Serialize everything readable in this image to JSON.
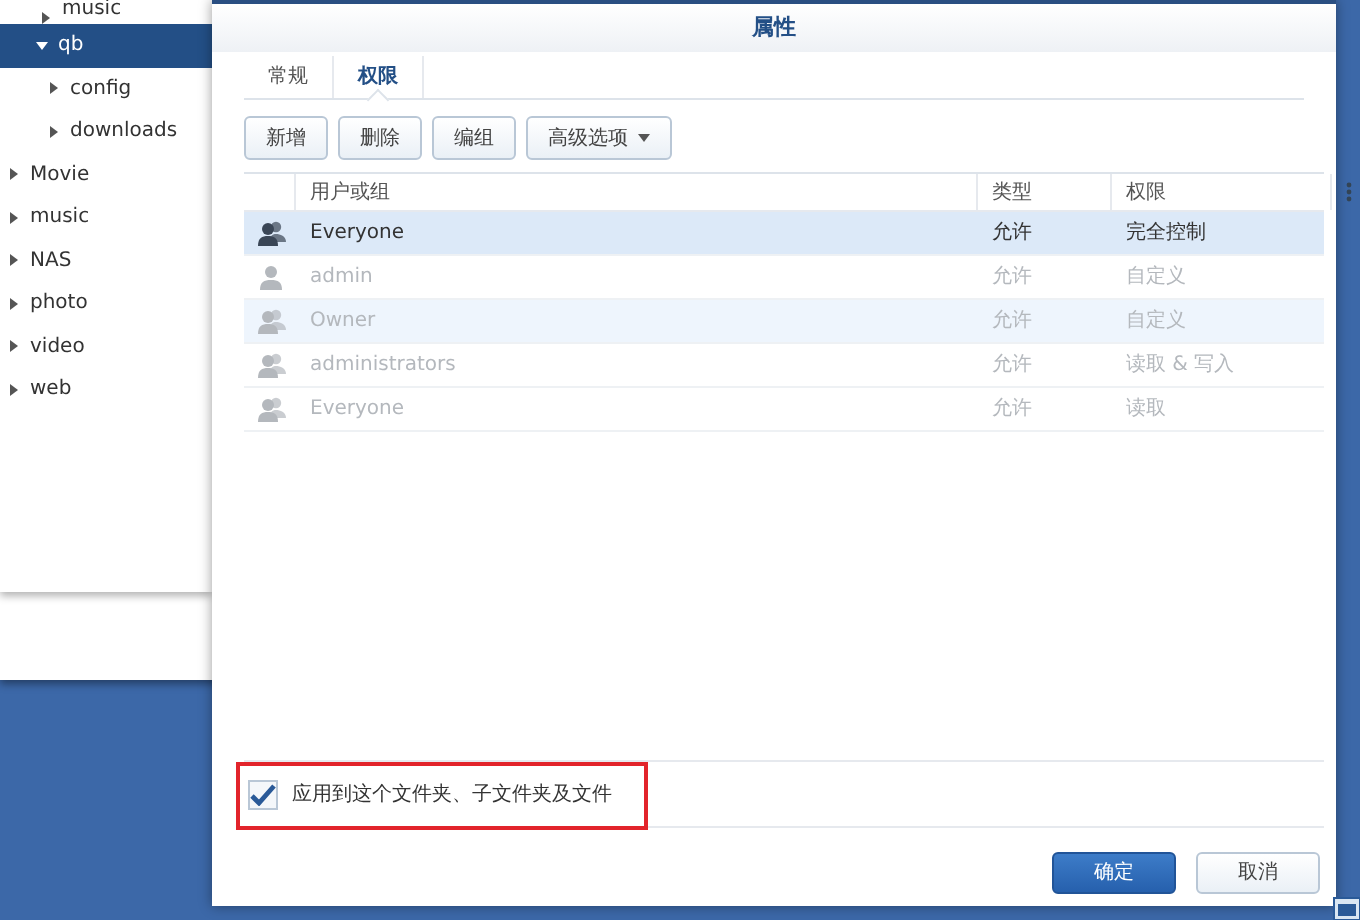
{
  "tree": {
    "items": [
      {
        "label": "music",
        "expanded": false,
        "selected": false
      },
      {
        "label": "qb",
        "expanded": true,
        "selected": true,
        "children": [
          {
            "label": "config",
            "expanded": false,
            "selected": false
          },
          {
            "label": "downloads",
            "expanded": false,
            "selected": false
          }
        ]
      },
      {
        "label": "Movie",
        "expanded": false,
        "selected": false
      },
      {
        "label": "music",
        "expanded": false,
        "selected": false
      },
      {
        "label": "NAS",
        "expanded": false,
        "selected": false
      },
      {
        "label": "photo",
        "expanded": false,
        "selected": false
      },
      {
        "label": "video",
        "expanded": false,
        "selected": false
      },
      {
        "label": "web",
        "expanded": false,
        "selected": false
      }
    ]
  },
  "dialog": {
    "title": "属性",
    "tabs": [
      {
        "label": "常规",
        "selected": false
      },
      {
        "label": "权限",
        "selected": true
      }
    ],
    "toolbar": [
      {
        "label": "新增",
        "kind": "button"
      },
      {
        "label": "删除",
        "kind": "button"
      },
      {
        "label": "编组",
        "kind": "button"
      },
      {
        "label": "高级选项",
        "kind": "dropdown"
      }
    ],
    "table": {
      "columns": [
        "用户或组",
        "类型",
        "权限"
      ],
      "rows": [
        {
          "kind": "group",
          "name": "Everyone",
          "type": "允许",
          "permission": "完全控制",
          "selected": true,
          "hovered": false,
          "disabled": false
        },
        {
          "kind": "user",
          "name": "admin",
          "type": "允许",
          "permission": "自定义",
          "selected": false,
          "hovered": false,
          "disabled": true
        },
        {
          "kind": "group",
          "name": "Owner",
          "type": "允许",
          "permission": "自定义",
          "selected": false,
          "hovered": true,
          "disabled": true
        },
        {
          "kind": "group",
          "name": "administrators",
          "type": "允许",
          "permission": "读取 & 写入",
          "selected": false,
          "hovered": false,
          "disabled": true
        },
        {
          "kind": "group",
          "name": "Everyone",
          "type": "允许",
          "permission": "读取",
          "selected": false,
          "hovered": false,
          "disabled": true
        }
      ]
    },
    "apply_checkbox": {
      "label": "应用到这个文件夹、子文件夹及文件",
      "checked": true,
      "highlighted": true
    },
    "buttons": [
      {
        "label": "确定",
        "kind": "primary"
      },
      {
        "label": "取消",
        "kind": "secondary"
      }
    ]
  }
}
